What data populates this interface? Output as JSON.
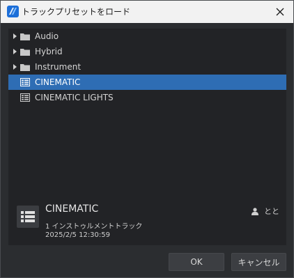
{
  "window": {
    "title": "トラックプリセットをロード",
    "accent_color": "#2e6db4"
  },
  "tree": {
    "items": [
      {
        "label": "Audio",
        "type": "folder",
        "icon": "folder-icon"
      },
      {
        "label": "Hybrid",
        "type": "folder",
        "icon": "folder-icon"
      },
      {
        "label": "Instrument",
        "type": "folder",
        "icon": "folder-icon"
      },
      {
        "label": "CINEMATIC",
        "type": "preset",
        "icon": "preset-icon",
        "selected": true
      },
      {
        "label": "CINEMATIC LIGHTS",
        "type": "preset",
        "icon": "preset-icon"
      }
    ]
  },
  "info": {
    "name": "CINEMATIC",
    "type": "1 インストゥルメントトラック",
    "date": "2025/2/5 12:30:59",
    "author": "とと"
  },
  "buttons": {
    "ok": "OK",
    "cancel": "キャンセル"
  }
}
